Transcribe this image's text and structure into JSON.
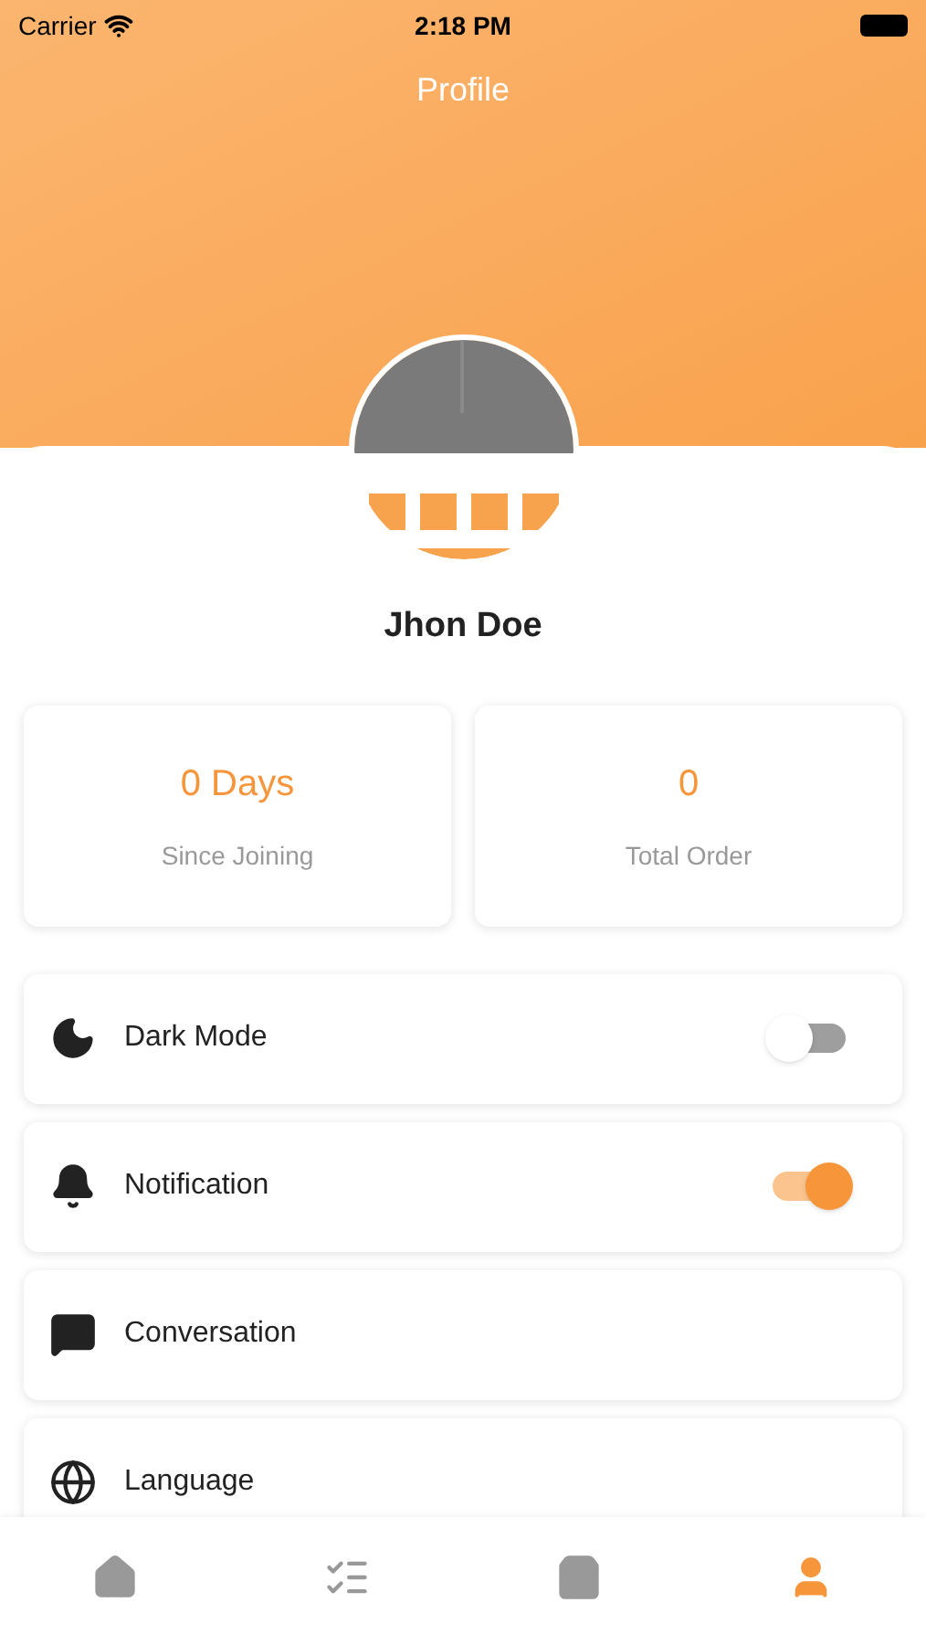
{
  "status_bar": {
    "carrier": "Carrier",
    "time": "2:18 PM"
  },
  "header": {
    "title": "Profile"
  },
  "profile": {
    "name": "Jhon Doe"
  },
  "stats": [
    {
      "value": "0 Days",
      "label": "Since Joining"
    },
    {
      "value": "0",
      "label": "Total Order"
    }
  ],
  "menu": [
    {
      "kind": "toggle",
      "label": "Dark Mode",
      "on": false
    },
    {
      "kind": "toggle",
      "label": "Notification",
      "on": true
    },
    {
      "kind": "link",
      "label": "Conversation"
    },
    {
      "kind": "link",
      "label": "Language"
    }
  ],
  "bottom_nav": [
    {
      "selected": false
    },
    {
      "selected": false
    },
    {
      "selected": false
    },
    {
      "selected": true
    }
  ]
}
